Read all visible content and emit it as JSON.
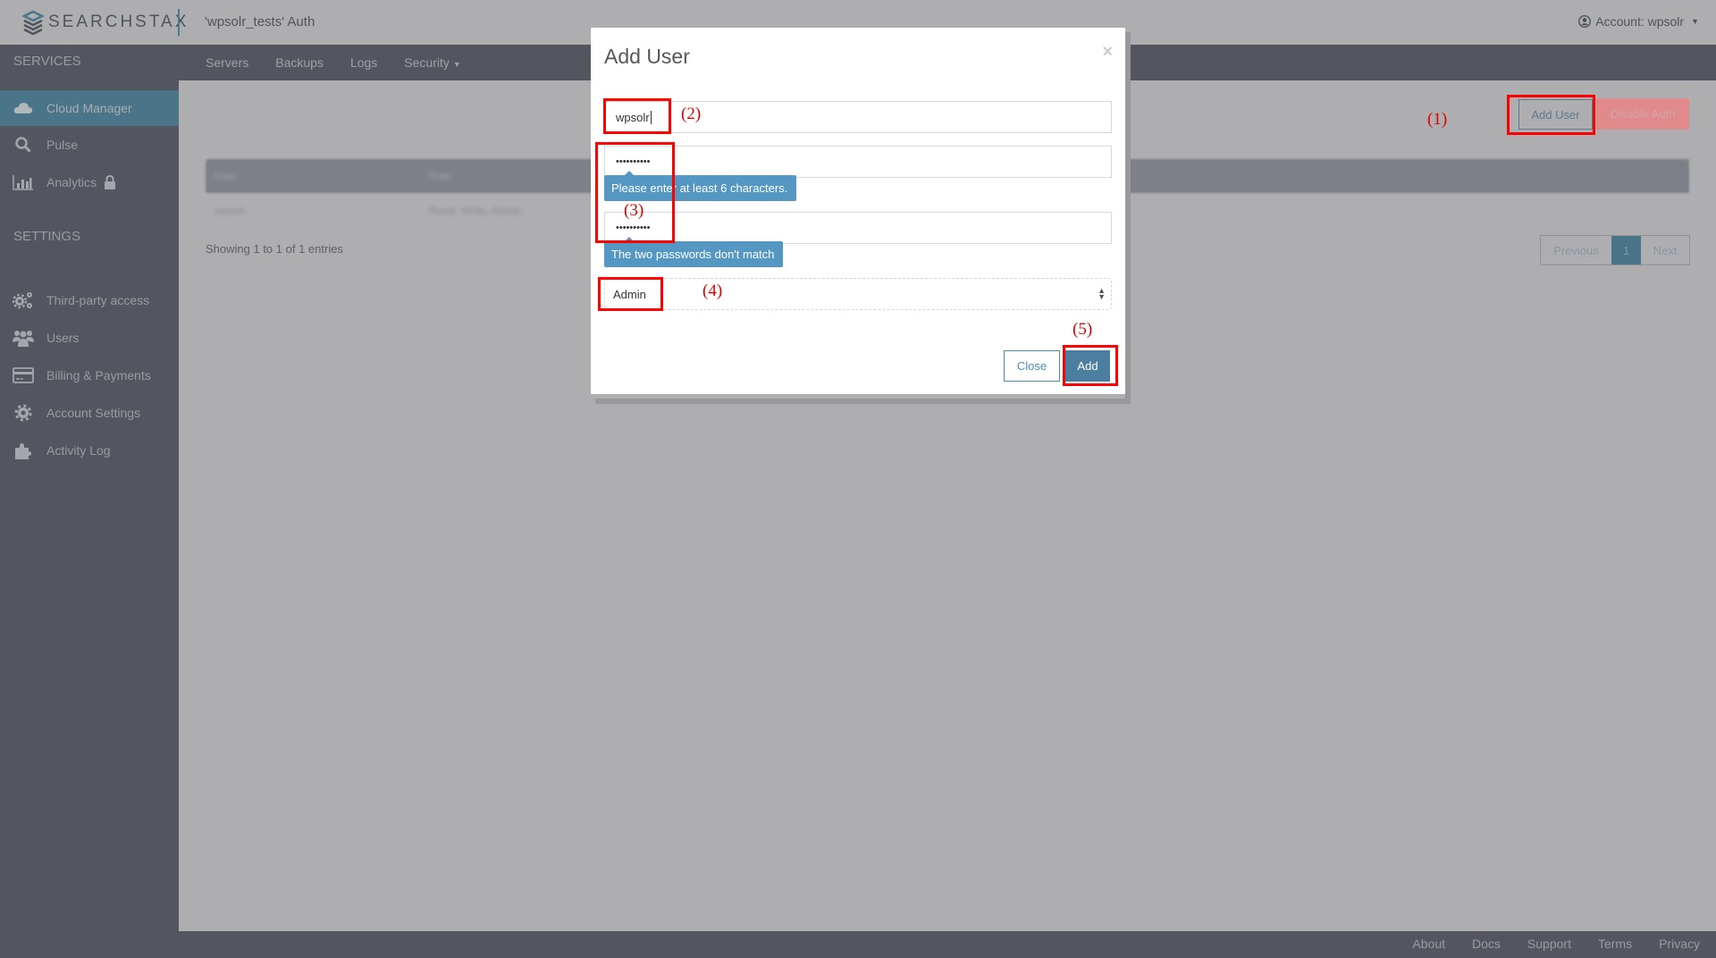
{
  "header": {
    "logo_text": "SEARCHSTAX",
    "page_title": "'wpsolr_tests' Auth",
    "account_label": "Account: wpsolr",
    "account_icon": "user-circle-icon"
  },
  "navbar": {
    "services_label": "SERVICES",
    "tabs": [
      {
        "label": "Servers"
      },
      {
        "label": "Backups"
      },
      {
        "label": "Logs"
      },
      {
        "label": "Security",
        "dropdown": true
      }
    ]
  },
  "sidebar": {
    "services": [
      {
        "label": "Cloud Manager",
        "icon": "cloud-icon",
        "active": true
      },
      {
        "label": "Pulse",
        "icon": "search-icon"
      },
      {
        "label": "Analytics",
        "icon": "bar-chart-icon",
        "locked": true
      }
    ],
    "settings_label": "SETTINGS",
    "settings": [
      {
        "label": "Third-party access",
        "icon": "gears-icon"
      },
      {
        "label": "Users",
        "icon": "users-icon"
      },
      {
        "label": "Billing & Payments",
        "icon": "credit-card-icon"
      },
      {
        "label": "Account Settings",
        "icon": "gear-icon"
      },
      {
        "label": "Activity Log",
        "icon": "puzzle-icon"
      }
    ]
  },
  "main": {
    "add_user_label": "Add User",
    "disable_auth_label": "Disable Auth",
    "table": {
      "headers": [
        "User",
        "Role"
      ],
      "rows": [
        [
          "wpsolr",
          "Read, Write, Admin"
        ]
      ]
    },
    "showing_text": "Showing 1 to 1 of 1 entries",
    "pagination": {
      "previous": "Previous",
      "current": "1",
      "next": "Next"
    }
  },
  "modal": {
    "title": "Add User",
    "close_symbol": "×",
    "username_value": "wpsolr",
    "password_value": "••••••••••",
    "confirm_password_value": "••••••••••",
    "password_tooltip": "Please enter at least 6 characters.",
    "confirm_tooltip": "The two passwords don't match",
    "role_value": "Admin",
    "close_label": "Close",
    "add_label": "Add"
  },
  "annotations": [
    "(1)",
    "(2)",
    "(3)",
    "(4)",
    "(5)"
  ],
  "footer": {
    "links": [
      "About",
      "Docs",
      "Support",
      "Terms",
      "Privacy"
    ]
  },
  "colors": {
    "accent": "#4a7588",
    "tooltip": "#5397c2",
    "danger": "#e08a8c",
    "annotation": "#ff0000"
  }
}
